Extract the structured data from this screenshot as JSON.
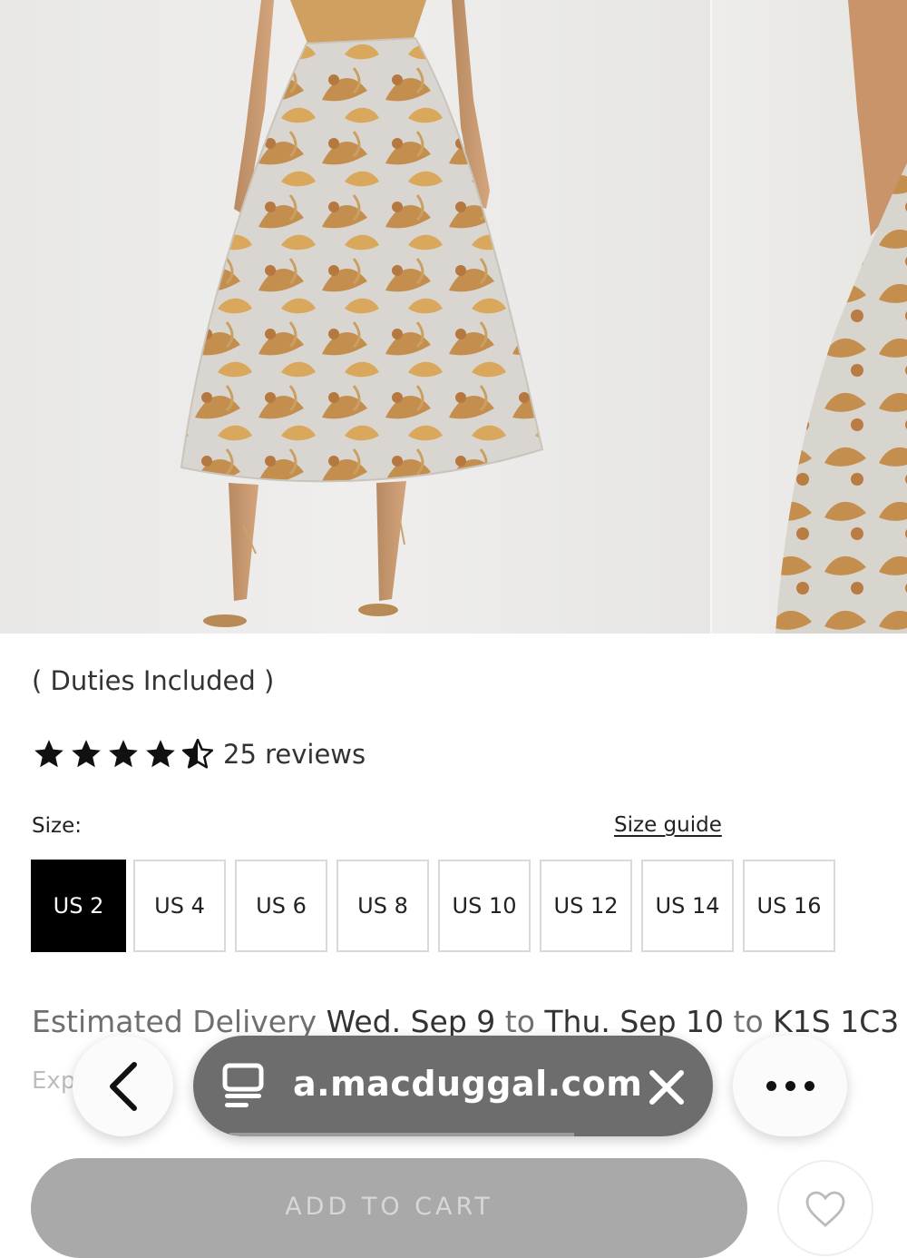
{
  "product": {
    "duties_note": "( Duties Included )",
    "rating": {
      "value": 4.5,
      "max": 5,
      "reviews_label": "25 reviews"
    },
    "size": {
      "label": "Size:",
      "guide_link": "Size guide",
      "options": [
        "US 2",
        "US 4",
        "US 6",
        "US 8",
        "US 10",
        "US 12",
        "US 14",
        "US 16"
      ],
      "selected": "US 2"
    },
    "delivery": {
      "prefix": "Estimated Delivery ",
      "start": "Wed. Sep 9",
      "to1": " to ",
      "end": "Thu. Sep 10",
      "to2": " to ",
      "postal": "K1S 1C3"
    },
    "express_partial": "Exp",
    "add_to_cart": "ADD TO CART"
  },
  "browser": {
    "url": "a.macduggal.com",
    "icons": {
      "back": "chevron-left-icon",
      "tabs": "tab-overview-icon",
      "close": "close-icon",
      "more": "more-dots-icon"
    }
  },
  "colors": {
    "selected_size_bg": "#000000",
    "url_bar_bg": "#6d6d6d",
    "cart_button_bg": "#a9a9a9"
  }
}
